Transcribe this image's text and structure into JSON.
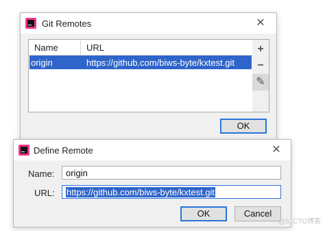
{
  "git_remotes": {
    "title": "Git Remotes",
    "close_glyph": "✕",
    "columns": [
      "Name",
      "URL"
    ],
    "rows": [
      {
        "name": "origin",
        "url": "https://github.com/biws-byte/kxtest.git",
        "selected": true
      }
    ],
    "toolbar": {
      "add": "+",
      "remove": "−",
      "edit": "✎"
    },
    "ok_label": "OK"
  },
  "define_remote": {
    "title": "Define Remote",
    "close_glyph": "✕",
    "name_label": "Name:",
    "name_value": "origin",
    "url_label": "URL:",
    "url_value": "https://github.com/biws-byte/kxtest.git",
    "ok_label": "OK",
    "cancel_label": "Cancel"
  },
  "watermark": "@51CTO博客",
  "colors": {
    "selection": "#2f65ca",
    "focus_border": "#2a74d8",
    "app_icon": "#f0338b"
  }
}
